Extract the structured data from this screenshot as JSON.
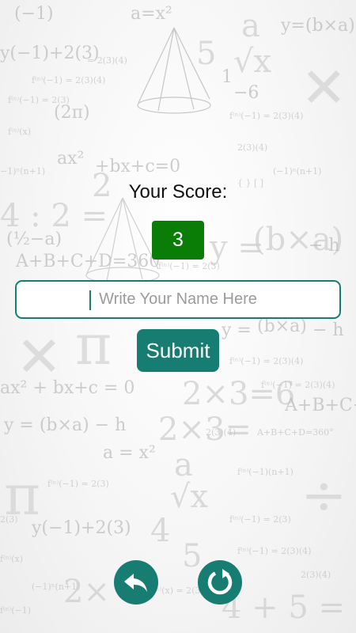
{
  "score": {
    "label": "Your Score:",
    "value": "3"
  },
  "name_input": {
    "placeholder": "Write Your Name Here",
    "value": ""
  },
  "submit": {
    "label": "Submit"
  },
  "bottom_buttons": {
    "back_icon": "back-arrow-icon",
    "restart_icon": "restart-icon"
  },
  "colors": {
    "primary": "#177d73",
    "score_badge": "#0a7d07",
    "text": "#111111"
  }
}
